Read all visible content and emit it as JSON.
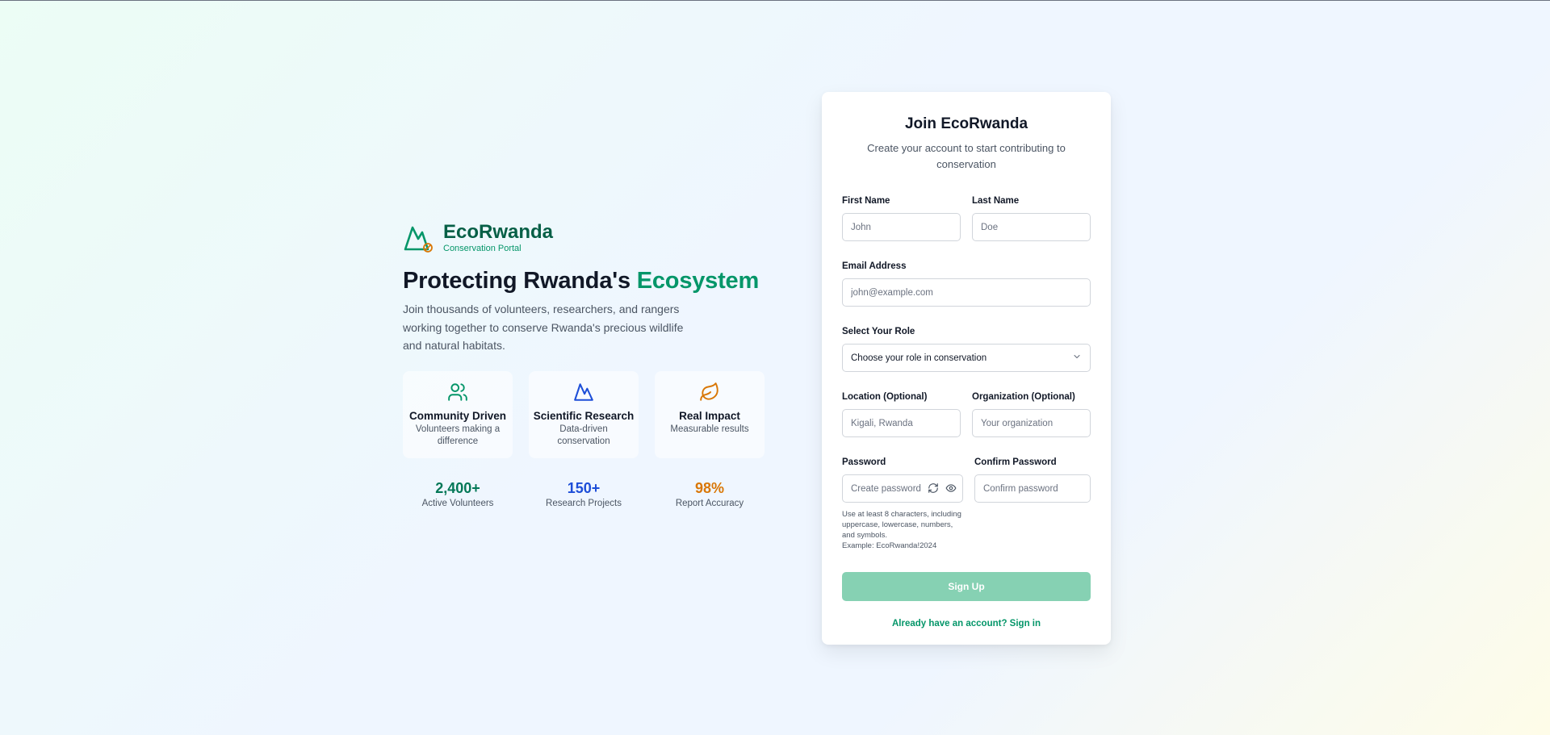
{
  "brand": {
    "name": "EcoRwanda",
    "subtitle": "Conservation Portal"
  },
  "hero": {
    "title_prefix": "Protecting Rwanda's ",
    "title_accent": "Ecosystem",
    "description": "Join thousands of volunteers, researchers, and rangers working together to conserve Rwanda's precious wildlife and natural habitats."
  },
  "features": [
    {
      "icon": "users-icon",
      "title": "Community Driven",
      "desc": "Volunteers making a difference",
      "color": "#059669"
    },
    {
      "icon": "mountain-icon",
      "title": "Scientific Research",
      "desc": "Data-driven conservation",
      "color": "#1d4ed8"
    },
    {
      "icon": "leaf-icon",
      "title": "Real Impact",
      "desc": "Measurable results",
      "color": "#d97706"
    }
  ],
  "stats": [
    {
      "value": "2,400+",
      "label": "Active Volunteers",
      "color": "#047857"
    },
    {
      "value": "150+",
      "label": "Research Projects",
      "color": "#1d4ed8"
    },
    {
      "value": "98%",
      "label": "Report Accuracy",
      "color": "#d97706"
    }
  ],
  "form": {
    "title": "Join EcoRwanda",
    "subtitle": "Create your account to start contributing to conservation",
    "first_name": {
      "label": "First Name",
      "placeholder": "John"
    },
    "last_name": {
      "label": "Last Name",
      "placeholder": "Doe"
    },
    "email": {
      "label": "Email Address",
      "placeholder": "john@example.com"
    },
    "role": {
      "label": "Select Your Role",
      "value": "Choose your role in conservation"
    },
    "location": {
      "label": "Location (Optional)",
      "placeholder": "Kigali, Rwanda"
    },
    "organization": {
      "label": "Organization (Optional)",
      "placeholder": "Your organization"
    },
    "password": {
      "label": "Password",
      "placeholder": "Create password"
    },
    "confirm_password": {
      "label": "Confirm Password",
      "placeholder": "Confirm password"
    },
    "password_hint": "Use at least 8 characters, including uppercase, lowercase, numbers, and symbols.",
    "password_example": "Example: EcoRwanda!2024",
    "submit": "Sign Up",
    "signin_link": "Already have an account? Sign in"
  },
  "colors": {
    "primary": "#059669",
    "button_disabled": "#86d1b3",
    "dark_green": "#065f46"
  }
}
